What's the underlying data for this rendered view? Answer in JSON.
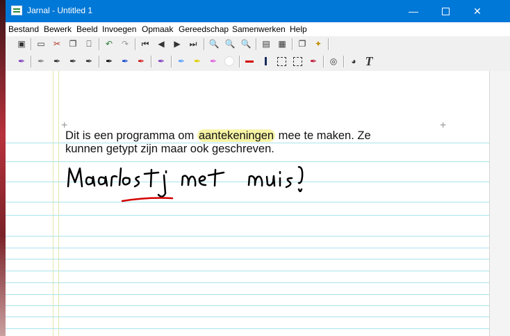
{
  "window": {
    "title": "Jarnal - Untitled 1"
  },
  "menu": [
    "Bestand",
    "Bewerk",
    "Beeld",
    "Invoegen",
    "Opmaak",
    "Gereedschap",
    "Samenwerken",
    "Help"
  ],
  "note": {
    "line1_before": "Dit is een programma om ",
    "line1_highlight": "aantekeningen",
    "line1_after": " mee te maken. Ze",
    "line2": "kunnen getypt zijn maar ook geschreven.",
    "handwriting": "Maar lostig met muis!"
  },
  "colors": {
    "titlebar": "#0078d7",
    "rule": "#a9e3ec",
    "highlight": "#f6f4a4",
    "ink": "#000000",
    "underline": "#d40000"
  }
}
